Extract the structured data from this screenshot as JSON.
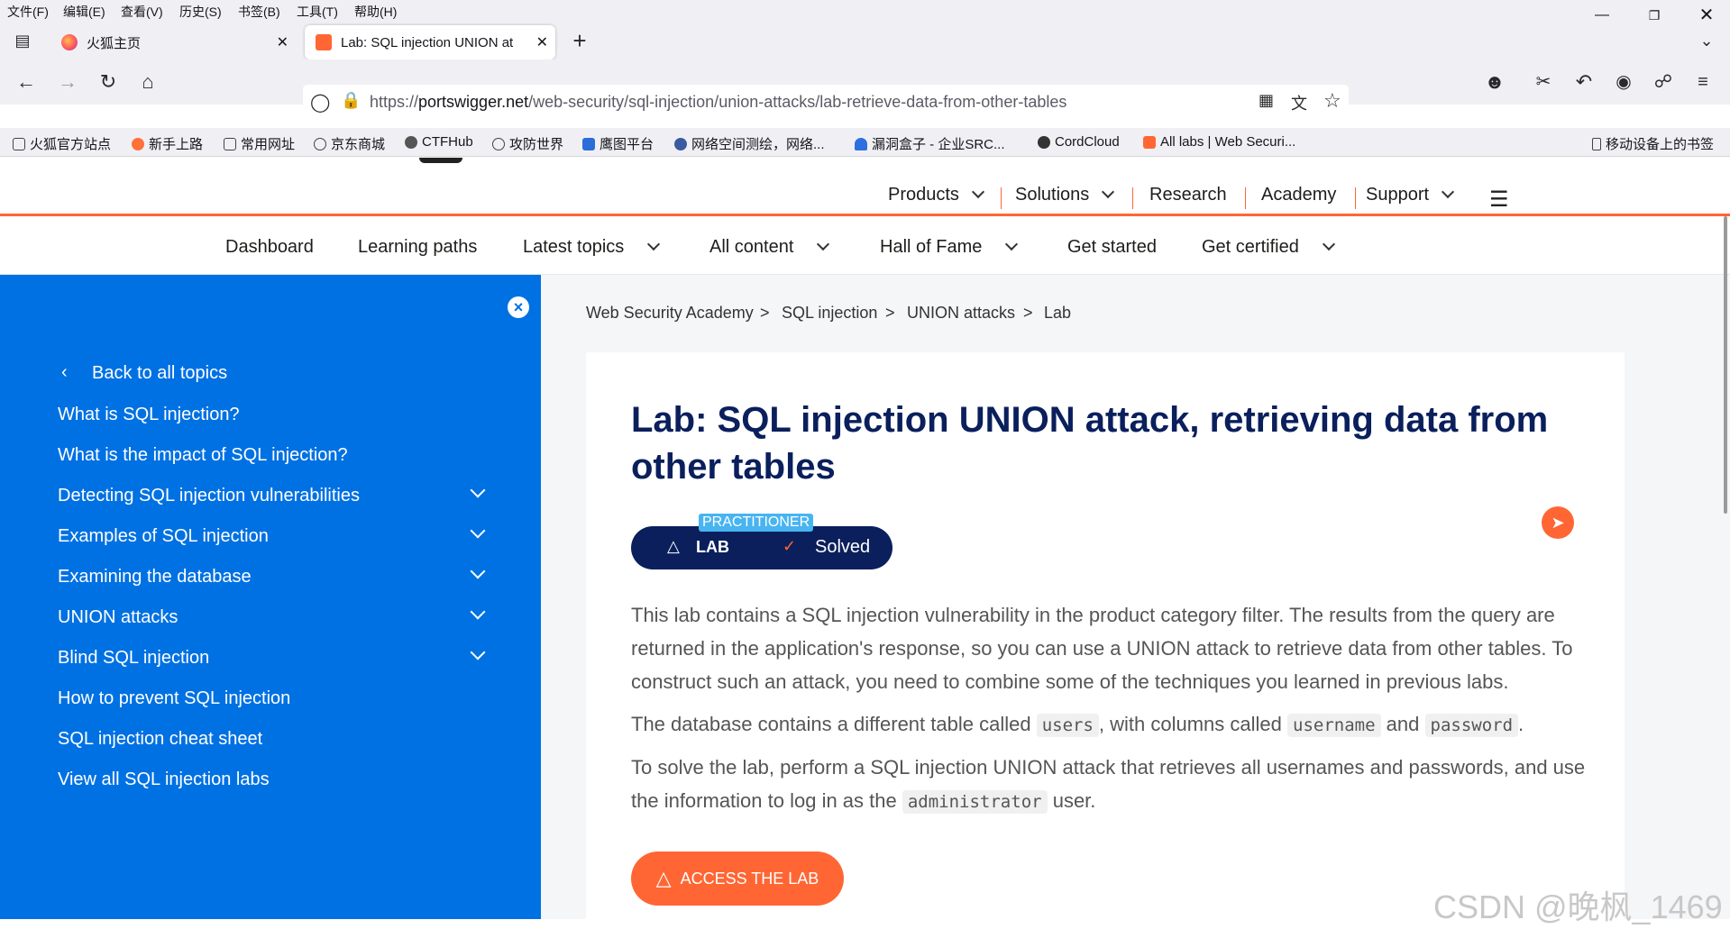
{
  "menubar": {
    "items": [
      "文件(F)",
      "编辑(E)",
      "查看(V)",
      "历史(S)",
      "书签(B)",
      "工具(T)",
      "帮助(H)"
    ]
  },
  "tabs": [
    {
      "label": "火狐主页",
      "favicon": "firefox-icon"
    },
    {
      "label": "Lab: SQL injection UNION at",
      "favicon": "portswigger-icon"
    }
  ],
  "address_bar": {
    "url_prefix": "https://",
    "url_domain": "portswigger.net",
    "url_path": "/web-security/sql-injection/union-attacks/lab-retrieve-data-from-other-tables"
  },
  "bookmarks": [
    {
      "label": "火狐官方站点",
      "icon": "folder-icon"
    },
    {
      "label": "新手上路",
      "icon": "firefox-icon"
    },
    {
      "label": "常用网址",
      "icon": "folder-icon"
    },
    {
      "label": "京东商城",
      "icon": "globe-icon"
    },
    {
      "label": "CTFHub",
      "icon": "ctfhub-icon"
    },
    {
      "label": "攻防世界",
      "icon": "globe-icon"
    },
    {
      "label": "鹰图平台",
      "icon": "hunter-icon"
    },
    {
      "label": "网络空间测绘，网络...",
      "icon": "fofa-icon"
    },
    {
      "label": "漏洞盒子 - 企业SRC...",
      "icon": "vulbox-icon"
    },
    {
      "label": "CordCloud",
      "icon": "cordcloud-icon"
    },
    {
      "label": "All labs | Web Securi...",
      "icon": "portswigger-icon"
    },
    {
      "label": "移动设备上的书签",
      "icon": "mobile-icon"
    }
  ],
  "site_nav": {
    "items": [
      "Products",
      "Solutions",
      "Research",
      "Academy",
      "Support"
    ]
  },
  "sub_nav": {
    "items": [
      "Dashboard",
      "Learning paths",
      "Latest topics",
      "All content",
      "Hall of Fame",
      "Get started",
      "Get certified"
    ]
  },
  "sidebar": {
    "back_label": "Back to all topics",
    "items": [
      {
        "label": "What is SQL injection?",
        "expandable": false
      },
      {
        "label": "What is the impact of SQL injection?",
        "expandable": false
      },
      {
        "label": "Detecting SQL injection vulnerabilities",
        "expandable": true
      },
      {
        "label": "Examples of SQL injection",
        "expandable": true
      },
      {
        "label": "Examining the database",
        "expandable": true
      },
      {
        "label": "UNION attacks",
        "expandable": true
      },
      {
        "label": "Blind SQL injection",
        "expandable": true
      },
      {
        "label": "How to prevent SQL injection",
        "expandable": false
      },
      {
        "label": "SQL injection cheat sheet",
        "expandable": false
      },
      {
        "label": "View all SQL injection labs",
        "expandable": false
      }
    ]
  },
  "breadcrumb": [
    "Web Security Academy",
    "SQL injection",
    "UNION attacks",
    "Lab"
  ],
  "lab": {
    "title": "Lab: SQL injection UNION attack, retrieving data from other tables",
    "level": "PRACTITIONER",
    "badge_label": "LAB",
    "status": "Solved",
    "para1": "This lab contains a SQL injection vulnerability in the product category filter. The results from the query are returned in the application's response, so you can use a UNION attack to retrieve data from other tables. To construct such an attack, you need to combine some of the techniques you learned in previous labs.",
    "para2_a": "The database contains a different table called",
    "code_users": "users",
    "para2_b": ", with columns called",
    "code_username": "username",
    "para2_c": "and",
    "code_password": "password",
    "para2_d": ".",
    "para3_a": "To solve the lab, perform a SQL injection UNION attack that retrieves all usernames and passwords, and use the information to log in as the",
    "code_admin": "administrator",
    "para3_b": "user.",
    "access_button": "ACCESS THE LAB"
  },
  "watermark": "CSDN @晚枫_1469",
  "colors": {
    "accent": "#ff6633",
    "sidebar": "#0071e3",
    "title": "#0a1f5c",
    "badge": "#0a1f5c",
    "practitioner": "#48b4f0"
  }
}
